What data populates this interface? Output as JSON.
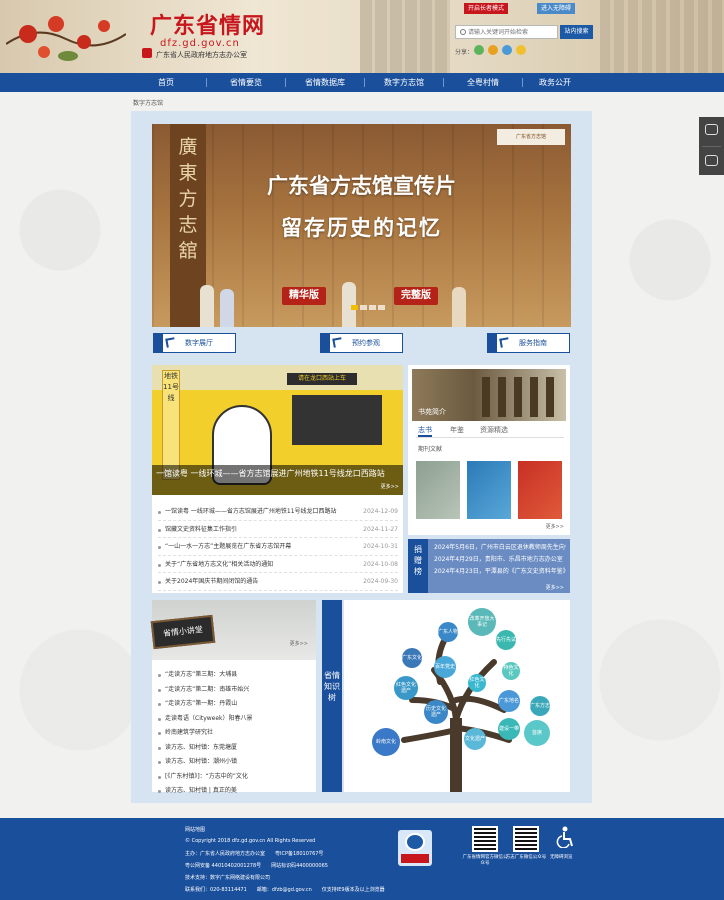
{
  "header": {
    "site_title": "广东省情网",
    "site_url": "dfz.gd.gov.cn",
    "site_sub": "广东省人民政府地方志办公室",
    "btn_elder": "开启长者模式",
    "btn_access": "进入无障碍",
    "search_placeholder": "请输入关键词开始检索",
    "search_button": "站内搜索",
    "share_label": "分享："
  },
  "nav": [
    "首页",
    "省情要览",
    "省情数据库",
    "数字方志馆",
    "全粤村情",
    "政务公开"
  ],
  "breadcrumb": "数字方志馆",
  "banner": {
    "vertical_text": "廣東方志舘",
    "logo_card": "广东省方志馆",
    "title1": "广东省方志馆宣传片",
    "title2": "留存历史的记忆",
    "pill_left": "精华版",
    "pill_right": "完整版"
  },
  "quick_links": [
    "数字展厅",
    "预约参观",
    "服务指南"
  ],
  "news": {
    "photo_pole": "地铁11号线",
    "photo_sign": "请在龙口西站上车",
    "caption": "一馆读粤 一线环城——省方志馆展进广州地铁11号线龙口西路站",
    "photo_more": "更多>>",
    "items": [
      {
        "title": "一馆读粤 一线环城——省方志馆展进广州地铁11号线龙口西路站",
        "date": "2024-12-09"
      },
      {
        "title": "馆藏文史资料征集工作指引",
        "date": "2024-11-27"
      },
      {
        "title": "“一山一水一方志”主题展览在广东省方志馆开幕",
        "date": "2024-10-31"
      },
      {
        "title": "关于“广东省地方志文化”相关活动的通知",
        "date": "2024-10-08"
      },
      {
        "title": "关于2024年国庆节期间闭馆的通告",
        "date": "2024-09-30"
      }
    ]
  },
  "library": {
    "photo_caption": "书苑简介",
    "tabs": [
      "志书",
      "年鉴",
      "资源精选"
    ],
    "sub": "期刊文献",
    "more": "更多>>"
  },
  "ranking": {
    "label": "捐赠榜",
    "items": [
      "2024年5月6日，广州市白云区退休教师周先生向省方志馆捐赠……",
      "2024年4月29日，贵阳市、乐昌市地方志办公室《乐昌……",
      "2024年4月23日，平潭县的《广东文史资料年鉴》……"
    ],
    "more": "更多>>"
  },
  "lecture": {
    "board": "省情小讲堂",
    "more": "更多>>",
    "items": [
      "“走读方志”第三期：大埔县",
      "“走读方志”第二期：南雄市始兴",
      "“走读方志”第一期：丹霞山",
      "走读粤语（Cityweek）阳春八景",
      "岭南建筑学研究社",
      "读方志、知村镇：东莞塘厦",
      "读方志、知村镇：潮州小镇",
      "[《广东村镇》]：“方志中的”文化",
      "读方志、知村镇 | 真正的美"
    ]
  },
  "knowledge": {
    "label": "省情知识树",
    "bubbles": [
      "改革开放大事记",
      "广东人物",
      "先行先试",
      "百年党史",
      "广东文化",
      "红色文化遗产",
      "特色文化",
      "红色文化",
      "广东地名",
      "历史文化遗产",
      "建设一带",
      "文化遗产",
      "广东方志",
      "岭南文化",
      "首席"
    ]
  },
  "footer": {
    "line0": "网站地图",
    "line1": "© Copyright 2018 dfz.gd.gov.cn All Rights Reserved",
    "line2": "主办：广东省人民政府地方志办公室　　粤ICP备18010767号",
    "line3": "粤公网安备 44010402001278号　　网站标识码4400000065",
    "line4": "技术支持：数字广东网络建设有限公司",
    "line5": "联系我们：020-83114471　　邮箱：dfzb@gd.gov.cn　　仅支持IE9版本及以上浏览器",
    "qr1_cap": "广东省情网官方微信公众号",
    "qr2_cap": "方志广东微信公众号",
    "acc_cap": "无障碍浏览"
  }
}
